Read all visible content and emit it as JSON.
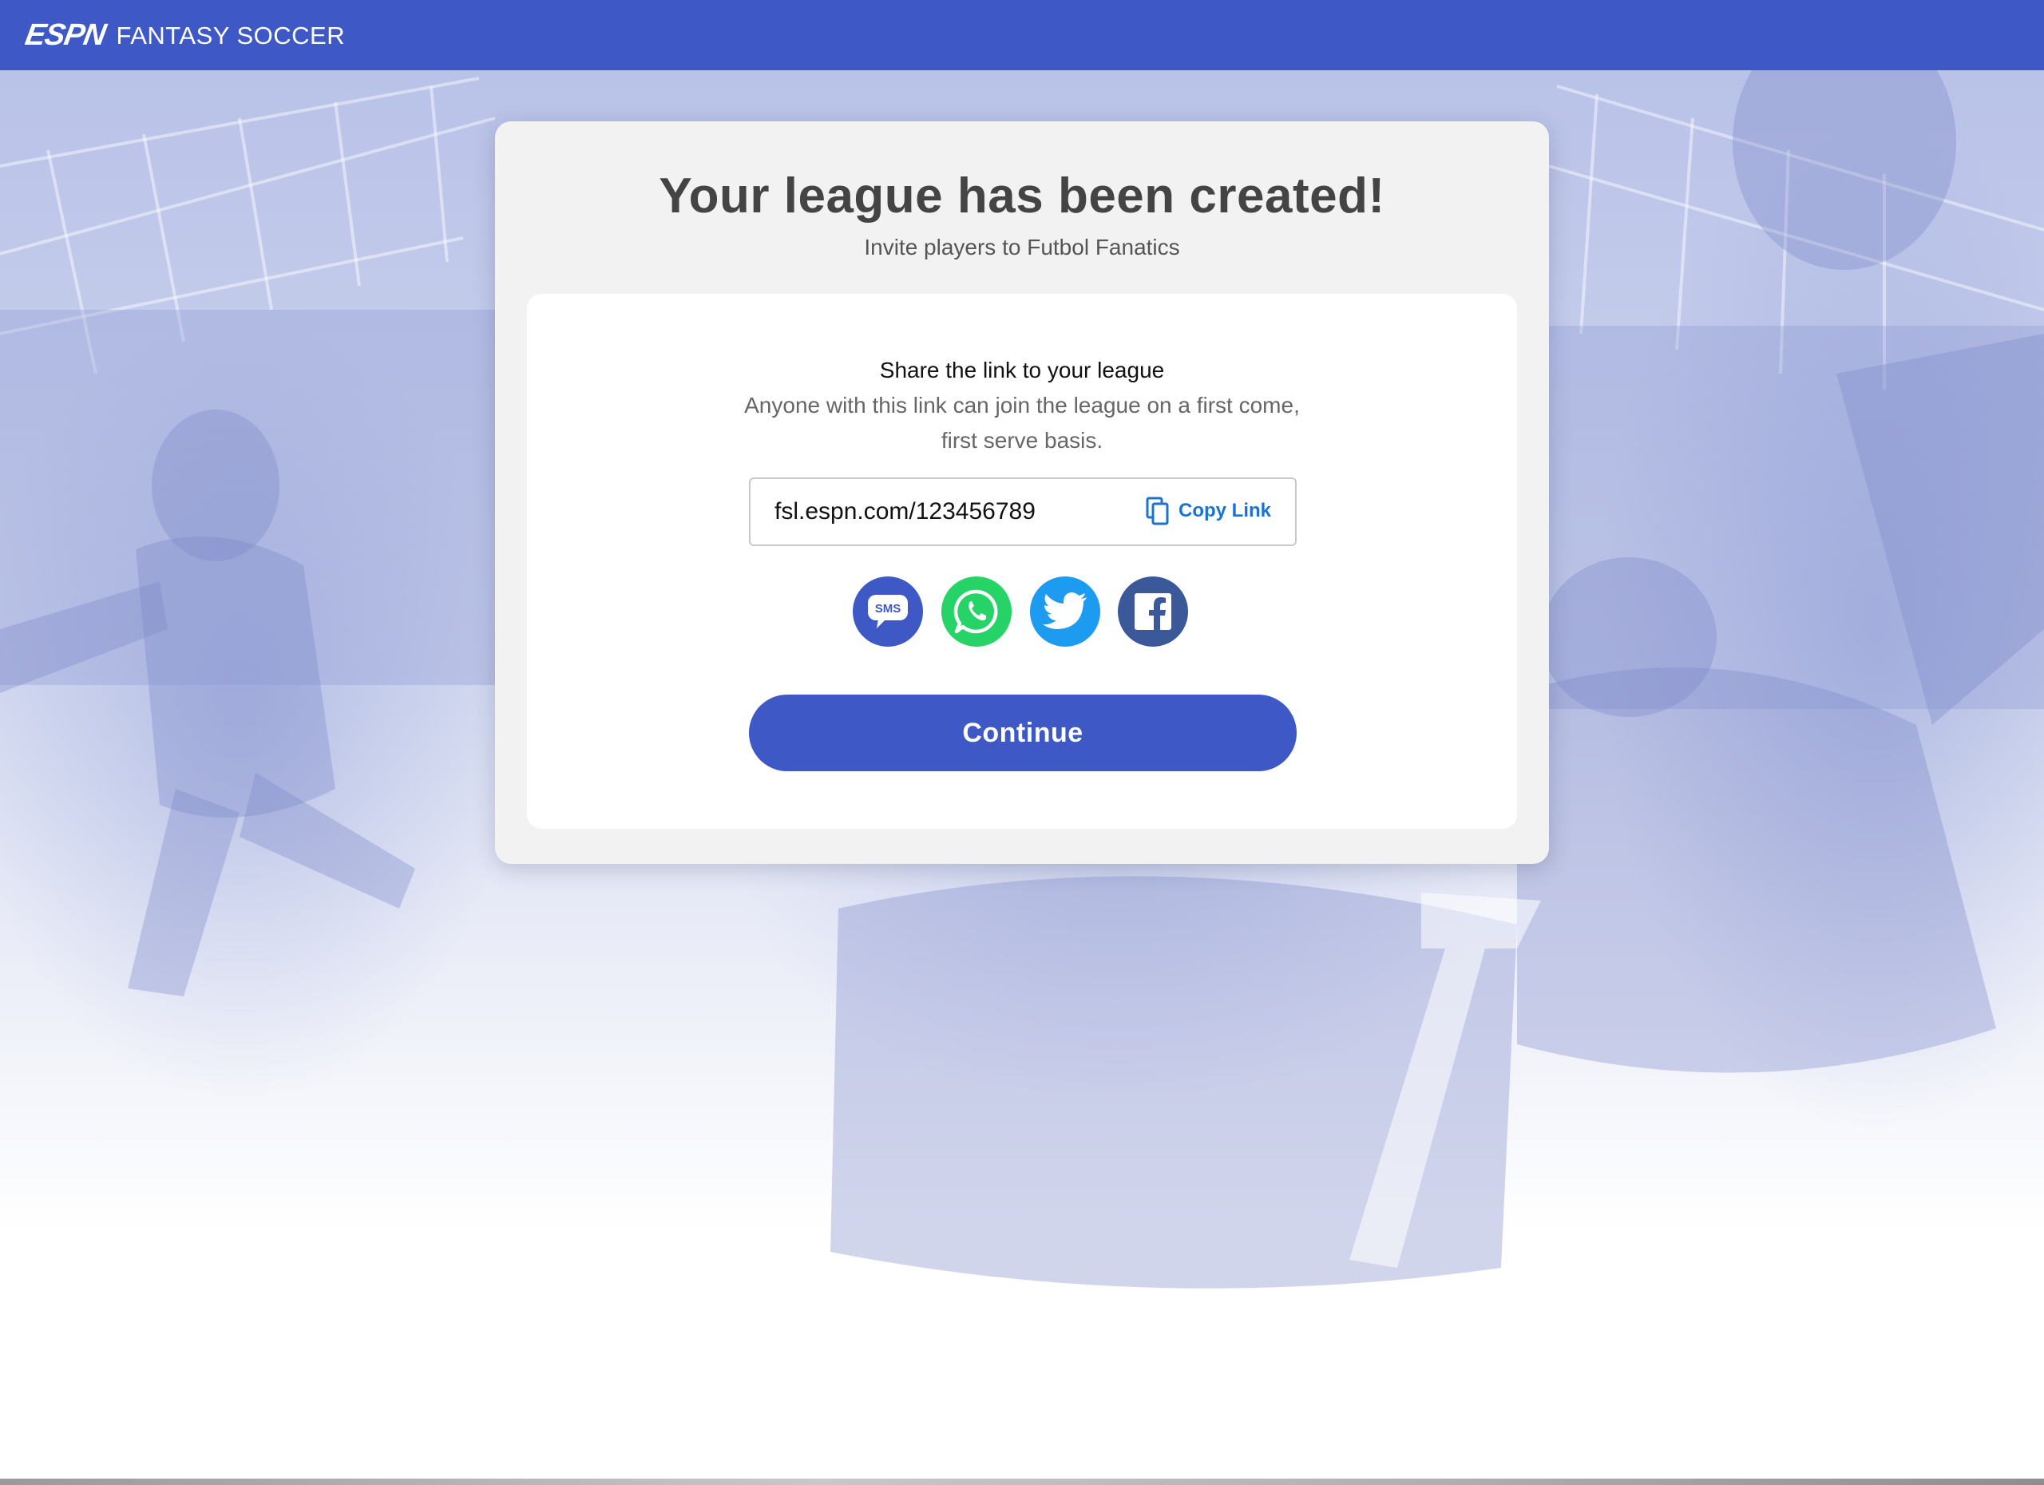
{
  "header": {
    "brand": "ESPN",
    "product": "FANTASY SOCCER"
  },
  "card": {
    "title": "Your league has been created!",
    "subtitle": "Invite players to Futbol Fanatics"
  },
  "share": {
    "title": "Share the link to your league",
    "description": "Anyone with this link can join the league on a first come, first serve basis.",
    "link_value": "fsl.espn.com/123456789",
    "copy_label": "Copy Link",
    "copy_icon": "copy-icon"
  },
  "social": {
    "sms_label": "SMS",
    "buttons": [
      {
        "name": "sms",
        "icon": "sms-icon",
        "color": "#3e58c6"
      },
      {
        "name": "whatsapp",
        "icon": "whatsapp-icon",
        "color": "#25d366"
      },
      {
        "name": "twitter",
        "icon": "twitter-icon",
        "color": "#1d9bf0"
      },
      {
        "name": "facebook",
        "icon": "facebook-icon",
        "color": "#3b5998"
      }
    ]
  },
  "actions": {
    "continue_label": "Continue"
  },
  "colors": {
    "brand_blue": "#3e58c6",
    "link_blue": "#1a73d0",
    "card_bg": "#f2f2f2",
    "title_text": "#444444"
  }
}
